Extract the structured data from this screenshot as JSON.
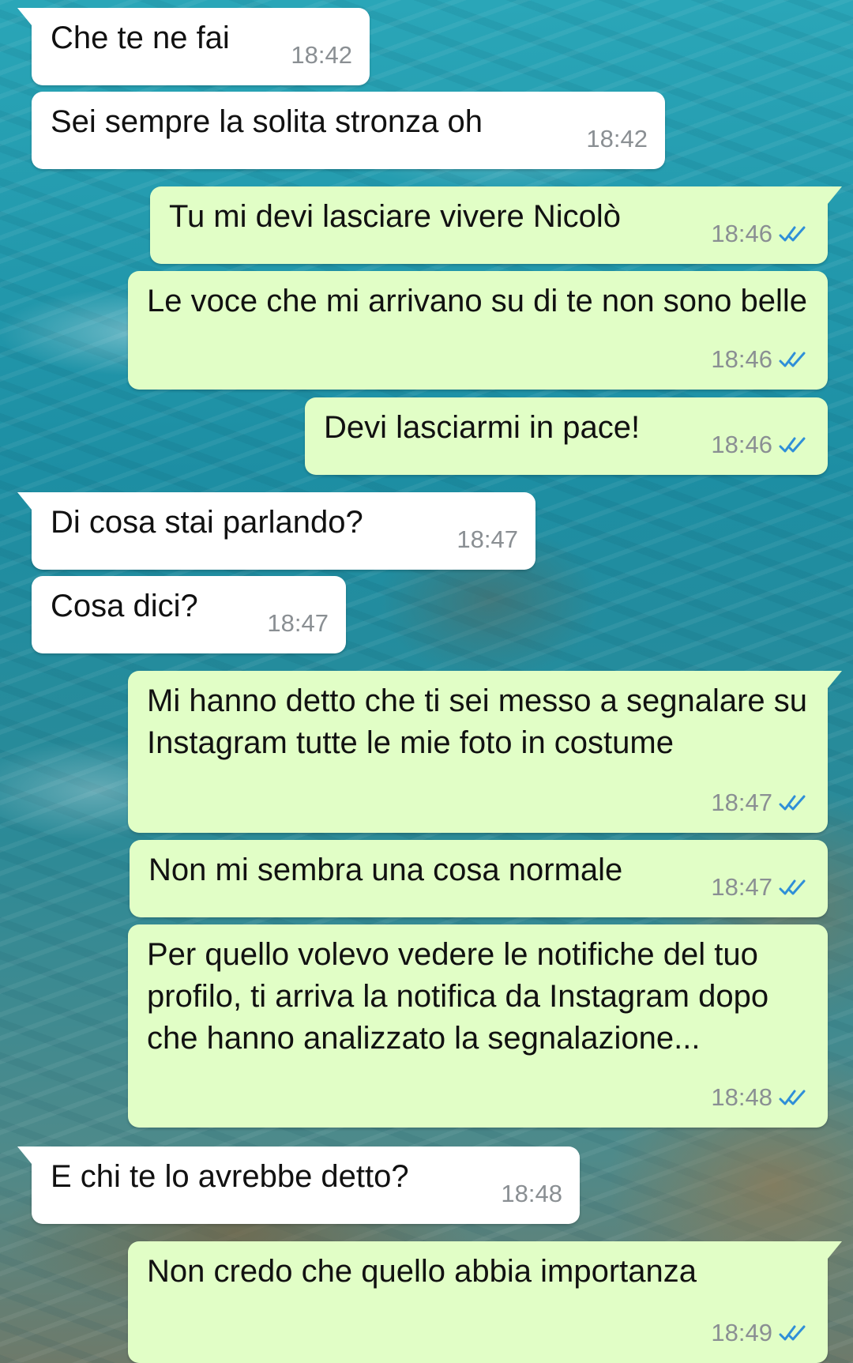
{
  "colors": {
    "incoming_bubble": "#ffffff",
    "outgoing_bubble": "#e1fec6",
    "timestamp": "#8a8f93",
    "read_check": "#2f8fd8"
  },
  "messages": [
    {
      "direction": "incoming",
      "text": "Che te ne fai",
      "time": "18:42"
    },
    {
      "direction": "incoming",
      "text": "Sei sempre la solita stronza oh",
      "time": "18:42"
    },
    {
      "direction": "outgoing",
      "text": "Tu mi devi lasciare vivere Nicolò",
      "time": "18:46",
      "status_icon": "double-check-read-icon"
    },
    {
      "direction": "outgoing",
      "text": "Le voce che mi arrivano su di te non sono belle",
      "time": "18:46",
      "status_icon": "double-check-read-icon"
    },
    {
      "direction": "outgoing",
      "text": "Devi lasciarmi in pace!",
      "time": "18:46",
      "status_icon": "double-check-read-icon"
    },
    {
      "direction": "incoming",
      "text": "Di cosa stai parlando?",
      "time": "18:47"
    },
    {
      "direction": "incoming",
      "text": "Cosa dici?",
      "time": "18:47"
    },
    {
      "direction": "outgoing",
      "text": "Mi hanno detto che ti sei messo a segnalare su Instagram tutte le mie foto in costume",
      "time": "18:47",
      "status_icon": "double-check-read-icon"
    },
    {
      "direction": "outgoing",
      "text": "Non mi sembra una cosa normale",
      "time": "18:47",
      "status_icon": "double-check-read-icon"
    },
    {
      "direction": "outgoing",
      "text": "Per quello volevo vedere le notifiche del tuo profilo, ti arriva la notifica da Instagram dopo che hanno analizzato la segnalazione...",
      "time": "18:48",
      "status_icon": "double-check-read-icon"
    },
    {
      "direction": "incoming",
      "text": "E chi te lo avrebbe detto?",
      "time": "18:48"
    },
    {
      "direction": "outgoing",
      "text": "Non credo che quello abbia importanza",
      "time": "18:49",
      "status_icon": "double-check-read-icon"
    }
  ]
}
